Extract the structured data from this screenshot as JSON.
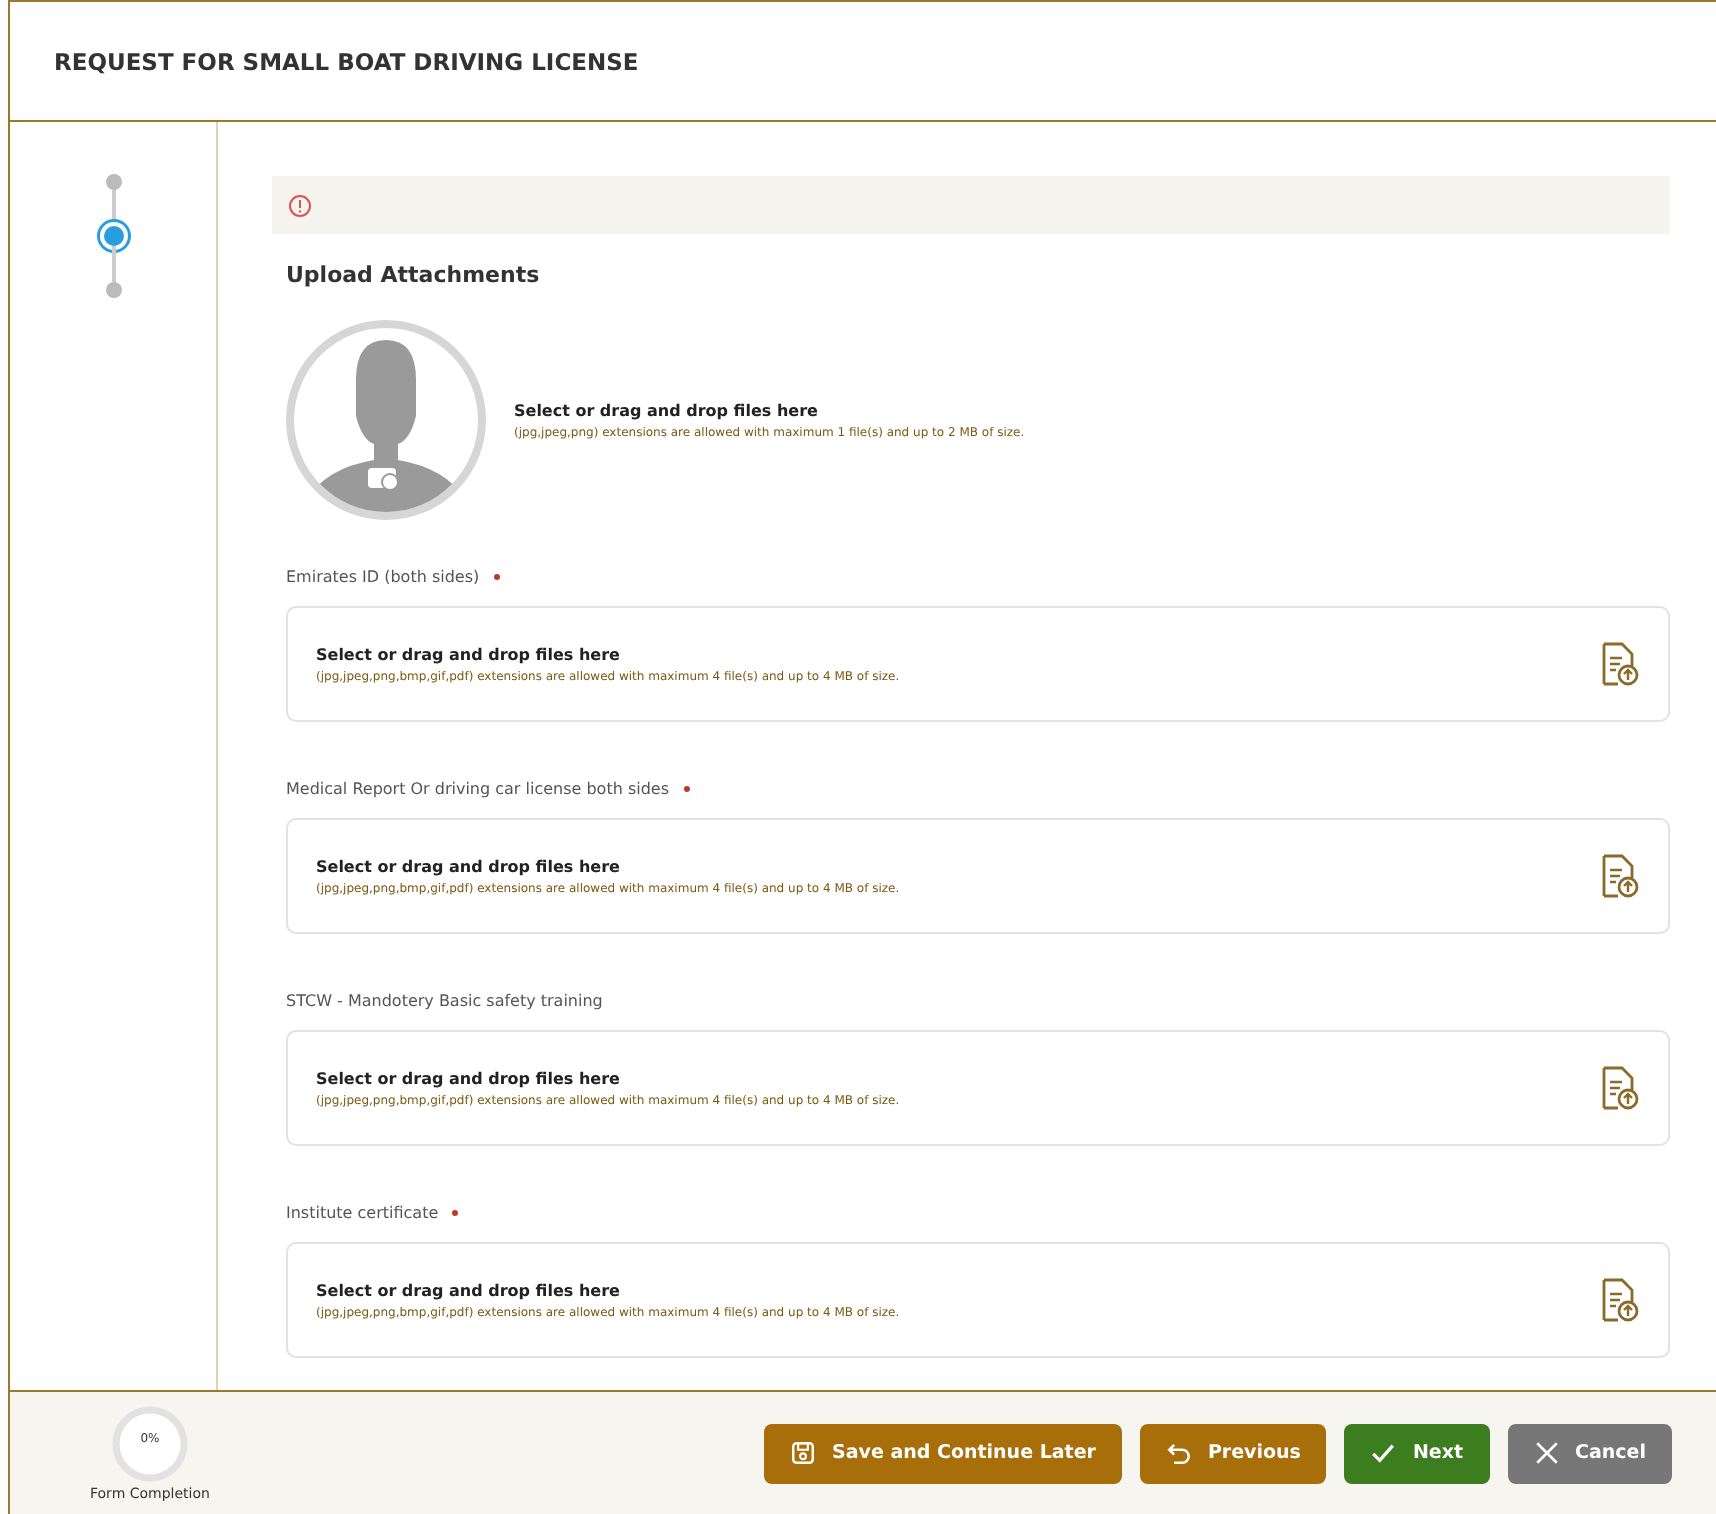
{
  "header": {
    "title": "REQUEST FOR SMALL BOAT DRIVING LICENSE"
  },
  "stepper": [
    {
      "selected": false
    },
    {
      "selected": true
    },
    {
      "selected": false
    }
  ],
  "section": {
    "title": "Upload Attachments"
  },
  "uploads": [
    {
      "kind": "avatar",
      "prompt": "Select or drag and drop files here",
      "hint": "(jpg,jpeg,png) extensions are allowed with maximum 1 file(s) and up to 2 MB of size."
    },
    {
      "kind": "file",
      "label": "Emirates ID (both sides)",
      "required": true,
      "prompt": "Select or drag and drop files here",
      "hint": "(jpg,jpeg,png,bmp,gif,pdf) extensions are allowed with maximum 4 file(s) and up to 4 MB of size."
    },
    {
      "kind": "file",
      "label": "Medical Report Or driving car license both sides",
      "required": true,
      "prompt": "Select or drag and drop files here",
      "hint": "(jpg,jpeg,png,bmp,gif,pdf) extensions are allowed with maximum 4 file(s) and up to 4 MB of size."
    },
    {
      "kind": "file",
      "label": "STCW - Mandotery Basic safety training",
      "required": false,
      "prompt": "Select or drag and drop files here",
      "hint": "(jpg,jpeg,png,bmp,gif,pdf) extensions are allowed with maximum 4 file(s) and up to 4 MB of size."
    },
    {
      "kind": "file",
      "label": "Institute certificate",
      "required": true,
      "prompt": "Select or drag and drop files here",
      "hint": "(jpg,jpeg,png,bmp,gif,pdf) extensions are allowed with maximum 4 file(s) and up to 4 MB of size."
    }
  ],
  "footer": {
    "completion": {
      "value": "0%",
      "label": "Form Completion"
    },
    "buttons": [
      {
        "kind": "save",
        "label": "Save and Continue Later"
      },
      {
        "kind": "previous",
        "label": "Previous"
      },
      {
        "kind": "next",
        "label": "Next"
      },
      {
        "kind": "cancel",
        "label": "Cancel"
      }
    ]
  }
}
